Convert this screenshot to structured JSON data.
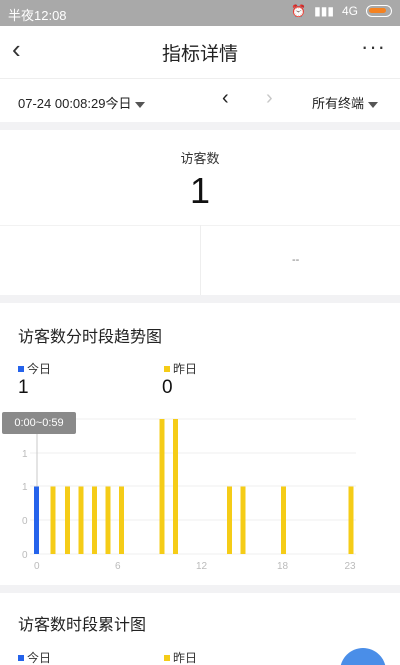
{
  "status_bar": {
    "time": "半夜12:08",
    "network": "4G"
  },
  "header": {
    "back_icon": "‹",
    "title": "指标详情",
    "more_icon": "···"
  },
  "filter": {
    "date": "07-24 00:08:29今日",
    "prev_icon": "‹",
    "next_icon": "›",
    "terminal": "所有终端"
  },
  "summary": {
    "label": "访客数",
    "value": "1",
    "compare": "--"
  },
  "trend": {
    "title": "访客数分时段趋势图",
    "legend": [
      {
        "name": "今日",
        "value": "1",
        "color": "#2563eb"
      },
      {
        "name": "昨日",
        "value": "0",
        "color": "#f5cc17"
      }
    ],
    "tooltip": "0:00~0:59"
  },
  "cumulative": {
    "title": "访客数时段累计图",
    "legend": [
      {
        "name": "今日",
        "color": "#2563eb"
      },
      {
        "name": "昨日",
        "color": "#f5cc17"
      }
    ]
  },
  "chart_data": {
    "type": "bar",
    "categories": [
      "0",
      "1",
      "2",
      "3",
      "4",
      "5",
      "6",
      "7",
      "8",
      "9",
      "10",
      "11",
      "12",
      "13",
      "14",
      "15",
      "16",
      "17",
      "18",
      "19",
      "20",
      "21",
      "22",
      "23"
    ],
    "series": [
      {
        "name": "今日",
        "values": [
          1,
          0,
          0,
          0,
          0,
          0,
          0,
          0,
          0,
          0,
          0,
          0,
          0,
          0,
          0,
          0,
          0,
          0,
          0,
          0,
          0,
          0,
          0,
          0
        ],
        "color": "#2563eb"
      },
      {
        "name": "昨日",
        "values": [
          0,
          1,
          1,
          1,
          1,
          1,
          1,
          0,
          0,
          2,
          2,
          0,
          0,
          0,
          1,
          1,
          0,
          0,
          1,
          0,
          0,
          0,
          0,
          1
        ],
        "color": "#f5cc17"
      }
    ],
    "y_ticks": [
      "0",
      "0",
      "1",
      "1",
      "1"
    ],
    "x_ticks": [
      "0",
      "6",
      "12",
      "18",
      "23"
    ],
    "ylim": [
      0,
      2
    ]
  }
}
